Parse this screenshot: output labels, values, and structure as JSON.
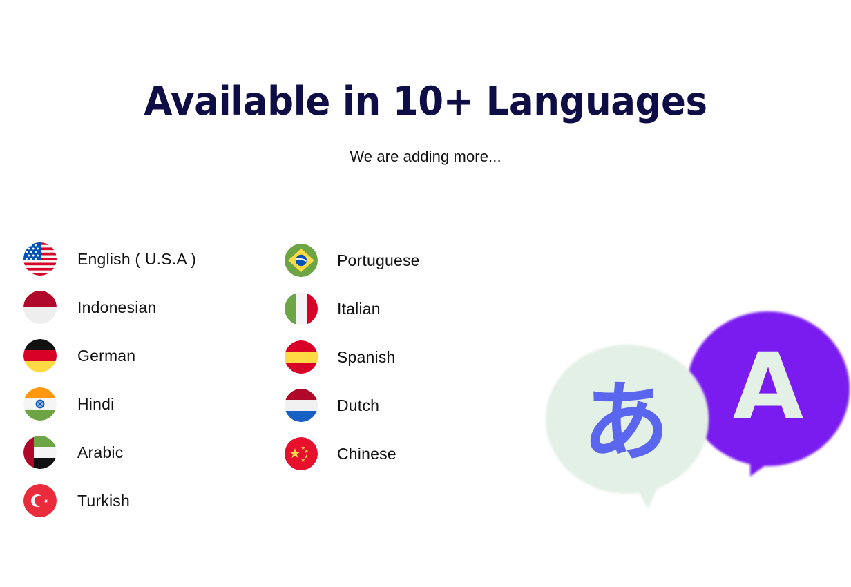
{
  "header": {
    "title": "Available in 10+ Languages",
    "subtitle": "We are adding more..."
  },
  "colors": {
    "title": "#0f0d45",
    "subtitle": "#121212",
    "label": "#111111",
    "bubble_purple": "#7a1ff0",
    "bubble_mint": "#e3f0e6",
    "glyph_blue": "#5b66ee",
    "background": "#ffffff"
  },
  "languages": {
    "columns": [
      {
        "items": [
          {
            "label": "English ( U.S.A )",
            "flag": "flag-usa-icon",
            "country": "United States"
          },
          {
            "label": "Indonesian",
            "flag": "flag-indonesia-icon",
            "country": "Indonesia"
          },
          {
            "label": "German",
            "flag": "flag-germany-icon",
            "country": "Germany"
          },
          {
            "label": "Hindi",
            "flag": "flag-india-icon",
            "country": "India"
          },
          {
            "label": "Arabic",
            "flag": "flag-uae-icon",
            "country": "United Arab Emirates"
          },
          {
            "label": "Turkish",
            "flag": "flag-turkey-icon",
            "country": "Turkey"
          }
        ]
      },
      {
        "items": [
          {
            "label": "Portuguese",
            "flag": "flag-brazil-icon",
            "country": "Brazil"
          },
          {
            "label": "Italian",
            "flag": "flag-italy-icon",
            "country": "Italy"
          },
          {
            "label": "Spanish",
            "flag": "flag-spain-icon",
            "country": "Spain"
          },
          {
            "label": "Dutch",
            "flag": "flag-netherlands-icon",
            "country": "Netherlands"
          },
          {
            "label": "Chinese",
            "flag": "flag-china-icon",
            "country": "China"
          }
        ]
      }
    ]
  },
  "illustration": {
    "name": "translation-speech-bubbles",
    "back_bubble_glyph": "A",
    "front_bubble_glyph": "あ"
  }
}
